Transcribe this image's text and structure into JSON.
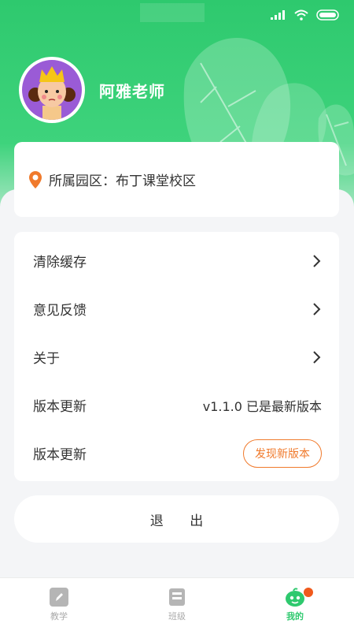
{
  "profile": {
    "name": "阿雅老师",
    "avatar_icon": "cartoon-girl-avatar"
  },
  "campus": {
    "label": "所属园区：布丁课堂校区",
    "icon": "location-pin-icon"
  },
  "menu": {
    "clear_cache": "清除缓存",
    "feedback": "意见反馈",
    "about": "关于",
    "version_label": "版本更新",
    "version_value": "v1.1.0 已是最新版本",
    "version_label_2": "版本更新",
    "new_version_button": "发现新版本"
  },
  "logout": "退 出",
  "tabs": [
    {
      "label": "教学",
      "icon": "pencil-icon"
    },
    {
      "label": "班级",
      "icon": "class-icon"
    },
    {
      "label": "我的",
      "icon": "mine-icon"
    }
  ],
  "colors": {
    "brand": "#2ec96e",
    "accent": "#f07a2c"
  }
}
